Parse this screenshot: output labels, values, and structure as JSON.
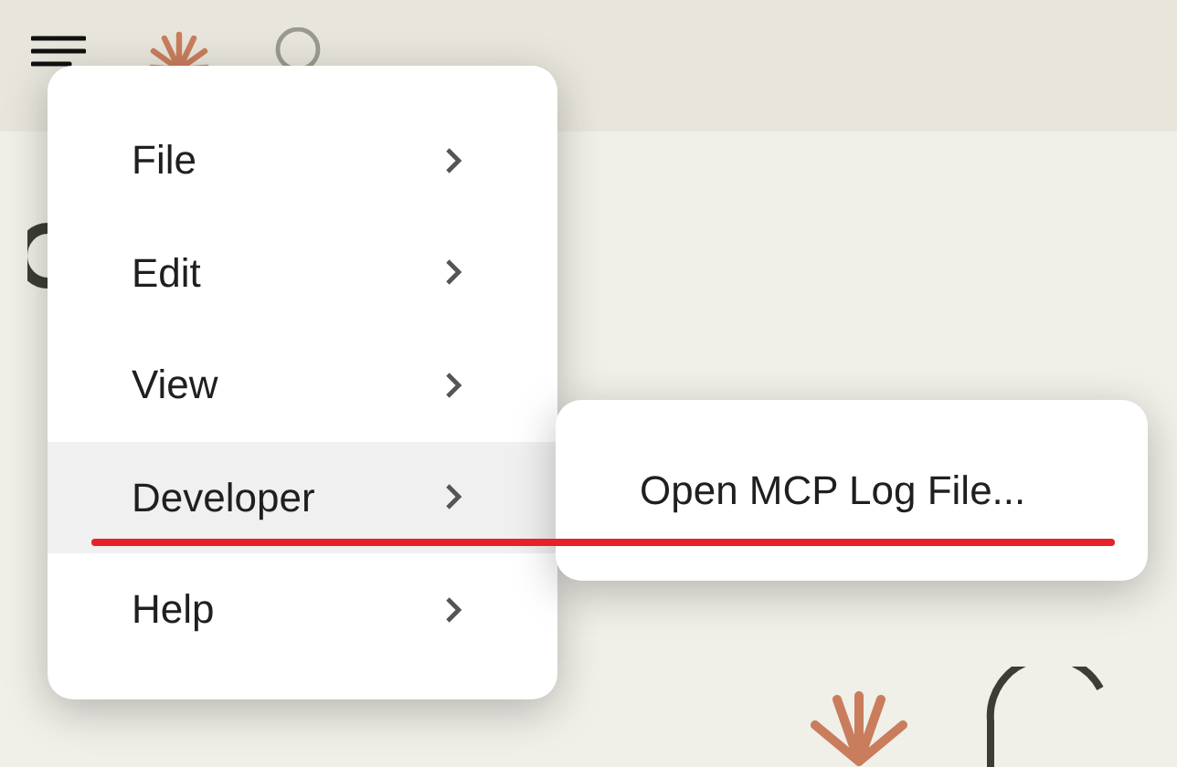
{
  "menu": {
    "items": [
      {
        "label": "File",
        "selected": false
      },
      {
        "label": "Edit",
        "selected": false
      },
      {
        "label": "View",
        "selected": false
      },
      {
        "label": "Developer",
        "selected": true
      },
      {
        "label": "Help",
        "selected": false
      }
    ]
  },
  "submenu": {
    "items": [
      {
        "label": "Open MCP Log File..."
      }
    ]
  }
}
